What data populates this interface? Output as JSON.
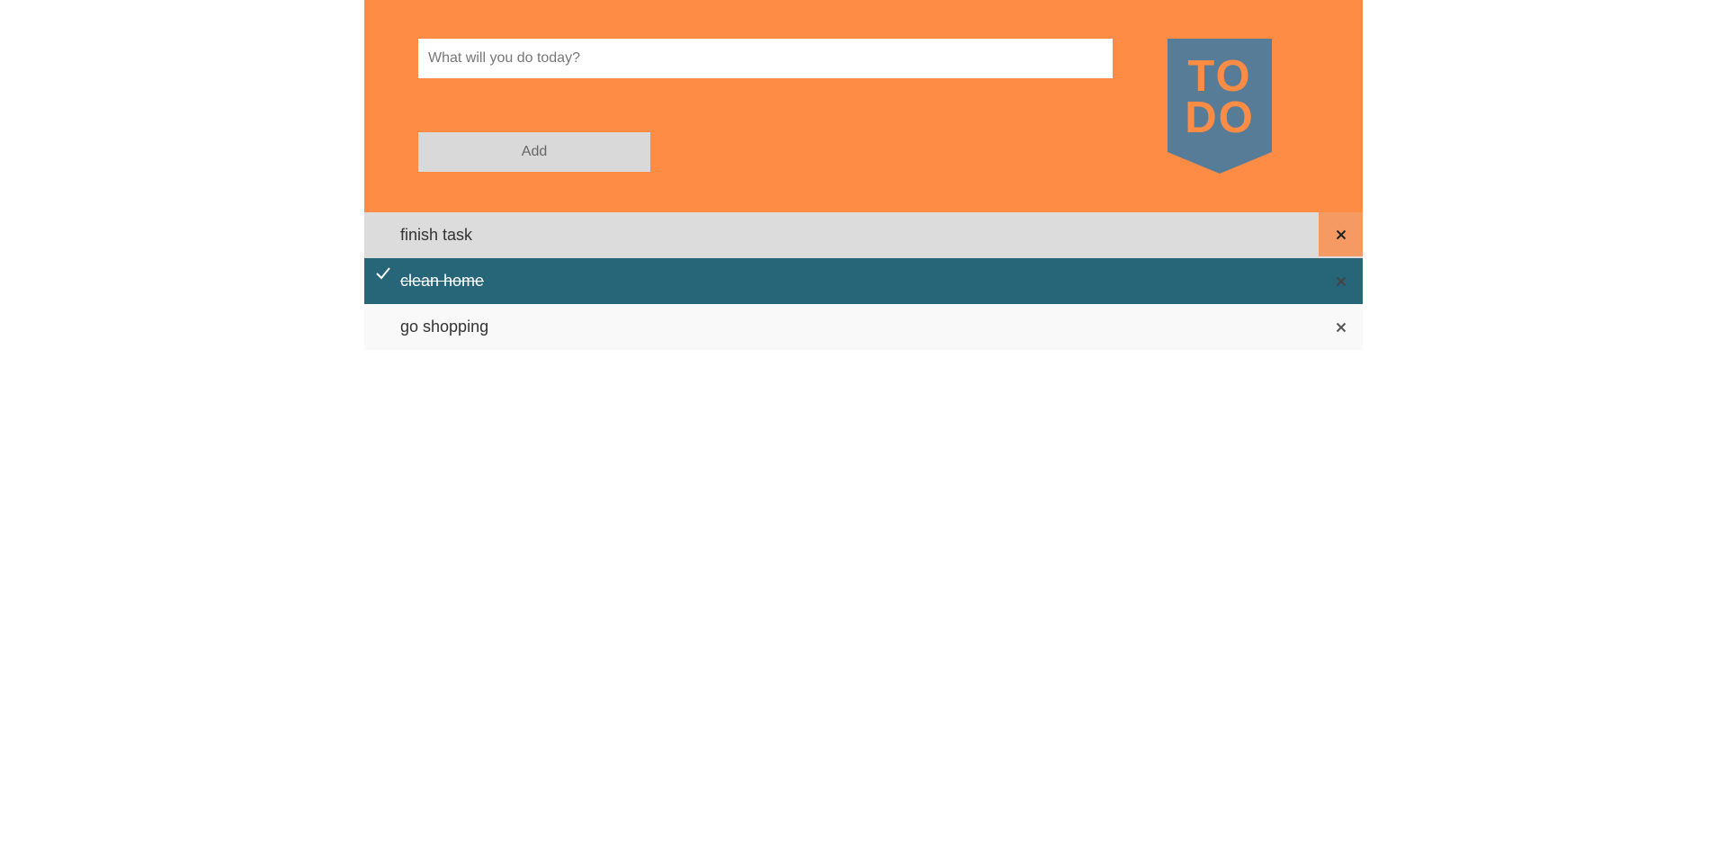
{
  "input": {
    "placeholder": "What will you do today?",
    "value": ""
  },
  "add_button": {
    "label": "Add"
  },
  "logo": {
    "text_line1": "TO",
    "text_line2": "DO",
    "badge_color": "#577c98",
    "text_color": "#ff8c44"
  },
  "colors": {
    "header_bg": "#ff8c44",
    "done_bg": "#276678"
  },
  "todos": [
    {
      "text": "finish task",
      "done": false
    },
    {
      "text": "clean home",
      "done": true
    },
    {
      "text": "go shopping",
      "done": false
    }
  ]
}
